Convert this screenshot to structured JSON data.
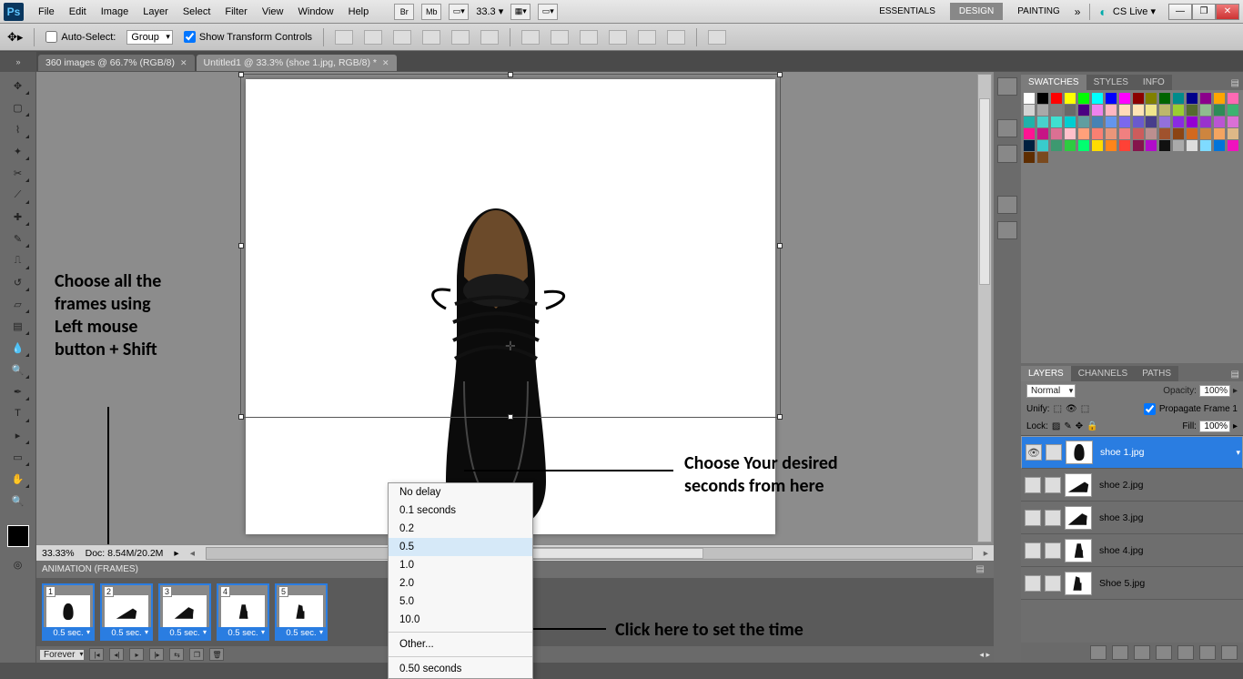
{
  "menubar": {
    "items": [
      "File",
      "Edit",
      "Image",
      "Layer",
      "Select",
      "Filter",
      "View",
      "Window",
      "Help"
    ],
    "zoom": "33.3",
    "workspaces": {
      "essentials": "ESSENTIALS",
      "design": "DESIGN",
      "painting": "PAINTING"
    },
    "cslive": "CS Live"
  },
  "options": {
    "auto_select_label": "Auto-Select:",
    "auto_select_value": "Group",
    "show_transform_label": "Show Transform Controls"
  },
  "tabs": [
    {
      "label": "360 images @ 66.7% (RGB/8)"
    },
    {
      "label": "Untitled1 @ 33.3% (shoe 1.jpg, RGB/8) *"
    }
  ],
  "status": {
    "zoom": "33.33%",
    "doc": "Doc: 8.54M/20.2M"
  },
  "animation": {
    "title": "ANIMATION (FRAMES)",
    "frames": [
      {
        "num": "1",
        "delay": "0.5 sec."
      },
      {
        "num": "2",
        "delay": "0.5 sec."
      },
      {
        "num": "3",
        "delay": "0.5 sec."
      },
      {
        "num": "4",
        "delay": "0.5 sec."
      },
      {
        "num": "5",
        "delay": "0.5 sec."
      }
    ],
    "loop": "Forever"
  },
  "ctx": {
    "items": [
      "No delay",
      "0.1 seconds",
      "0.2",
      "0.5",
      "1.0",
      "2.0",
      "5.0",
      "10.0"
    ],
    "other": "Other...",
    "current": "0.50 seconds"
  },
  "right": {
    "swatches_tab": "SWATCHES",
    "styles_tab": "STYLES",
    "info_tab": "INFO",
    "layers_tab": "LAYERS",
    "channels_tab": "CHANNELS",
    "paths_tab": "PATHS",
    "blend": "Normal",
    "opacity_lbl": "Opacity:",
    "opacity": "100%",
    "unify": "Unify:",
    "propagate": "Propagate Frame 1",
    "lock": "Lock:",
    "fill_lbl": "Fill:",
    "fill": "100%",
    "layers": [
      {
        "name": "shoe 1.jpg",
        "visible": true,
        "selected": true
      },
      {
        "name": "shoe 2.jpg",
        "visible": false,
        "selected": false
      },
      {
        "name": "shoe 3.jpg",
        "visible": false,
        "selected": false
      },
      {
        "name": "shoe 4.jpg",
        "visible": false,
        "selected": false
      },
      {
        "name": "Shoe 5.jpg",
        "visible": false,
        "selected": false
      }
    ]
  },
  "annotations": {
    "a1": "Choose all the\nframes using\nLeft mouse\nbutton + Shift",
    "a2": "Choose Your desired\nseconds from here",
    "a3": "Click here to set the time"
  },
  "swatch_colors": [
    "#ffffff",
    "#000000",
    "#ff0000",
    "#ffff00",
    "#00ff00",
    "#00ffff",
    "#0000ff",
    "#ff00ff",
    "#8b0000",
    "#808000",
    "#006400",
    "#008b8b",
    "#00008b",
    "#8b008b",
    "#ffa500",
    "#ff69b4",
    "#d3d3d3",
    "#a9a9a9",
    "#808080",
    "#696969",
    "#4b0082",
    "#ee82ee",
    "#ffb6c1",
    "#ffdab9",
    "#ffe4b5",
    "#f0e68c",
    "#bdb76b",
    "#9acd32",
    "#556b2f",
    "#8fbc8f",
    "#2e8b57",
    "#3cb371",
    "#20b2aa",
    "#48d1cc",
    "#40e0d0",
    "#00ced1",
    "#5f9ea0",
    "#4682b4",
    "#6495ed",
    "#7b68ee",
    "#6a5acd",
    "#483d8b",
    "#9370db",
    "#8a2be2",
    "#9400d3",
    "#9932cc",
    "#ba55d3",
    "#da70d6",
    "#ff1493",
    "#c71585",
    "#db7093",
    "#ffc0cb",
    "#ffa07a",
    "#fa8072",
    "#e9967a",
    "#f08080",
    "#cd5c5c",
    "#bc8f8f",
    "#a0522d",
    "#8b4513",
    "#d2691e",
    "#cd853f",
    "#f4a460",
    "#deb887",
    "#001f3f",
    "#39cccc",
    "#3d9970",
    "#2ecc40",
    "#01ff70",
    "#ffdc00",
    "#ff851b",
    "#ff4136",
    "#85144b",
    "#b10dc9",
    "#111111",
    "#aaaaaa",
    "#dddddd",
    "#7fdbff",
    "#0074d9",
    "#f012be",
    "#5e2d00",
    "#7a4a1f"
  ]
}
